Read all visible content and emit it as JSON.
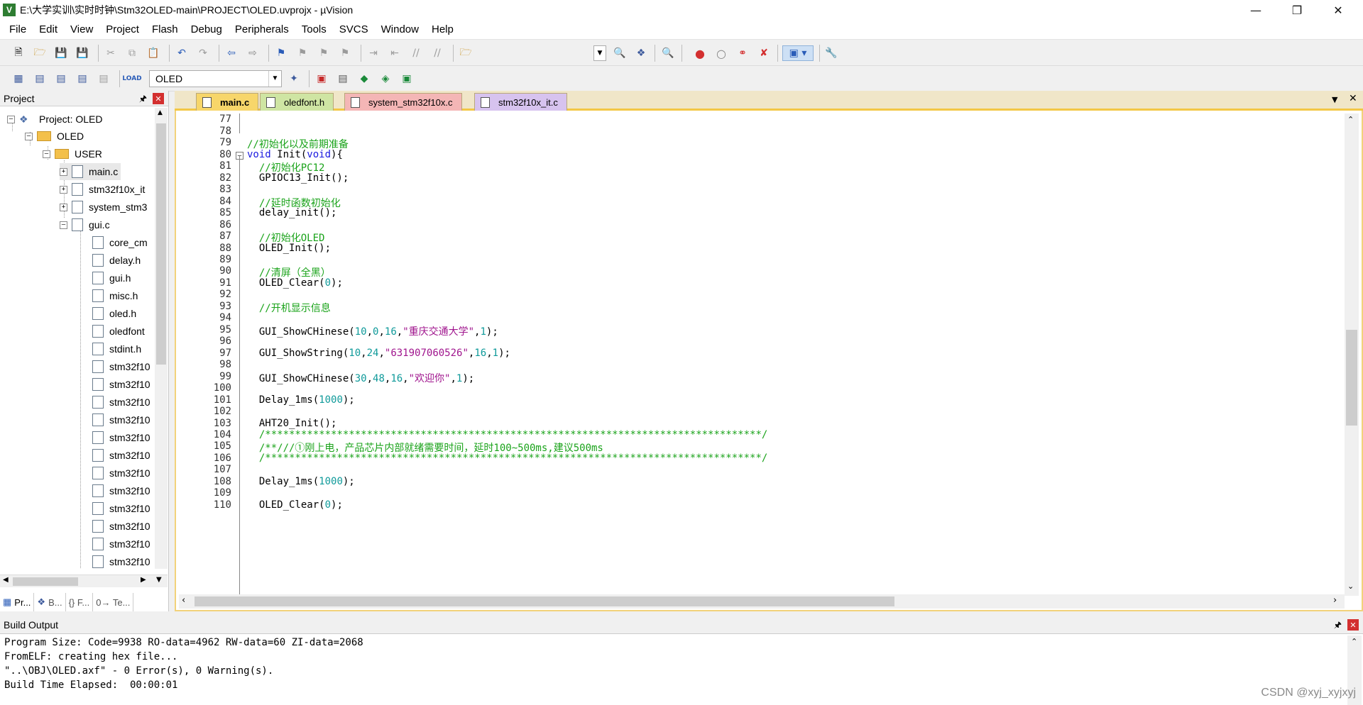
{
  "window": {
    "title": "E:\\大学实训\\实时时钟\\Stm32OLED-main\\PROJECT\\OLED.uvprojx - µVision",
    "app_icon": "V"
  },
  "menu": [
    "File",
    "Edit",
    "View",
    "Project",
    "Flash",
    "Debug",
    "Peripherals",
    "Tools",
    "SVCS",
    "Window",
    "Help"
  ],
  "toolbar": {
    "target_select": "OLED"
  },
  "project_panel": {
    "title": "Project",
    "tree": [
      {
        "label": "Project: OLED"
      },
      {
        "label": "OLED"
      },
      {
        "label": "USER"
      },
      {
        "label": "main.c"
      },
      {
        "label": "stm32f10x_it"
      },
      {
        "label": "system_stm3"
      },
      {
        "label": "gui.c"
      },
      {
        "label": "core_cm"
      },
      {
        "label": "delay.h"
      },
      {
        "label": "gui.h"
      },
      {
        "label": "misc.h"
      },
      {
        "label": "oled.h"
      },
      {
        "label": "oledfont"
      },
      {
        "label": "stdint.h"
      },
      {
        "label": "stm32f10"
      },
      {
        "label": "stm32f10"
      },
      {
        "label": "stm32f10"
      },
      {
        "label": "stm32f10"
      },
      {
        "label": "stm32f10"
      },
      {
        "label": "stm32f10"
      },
      {
        "label": "stm32f10"
      },
      {
        "label": "stm32f10"
      },
      {
        "label": "stm32f10"
      },
      {
        "label": "stm32f10"
      },
      {
        "label": "stm32f10"
      },
      {
        "label": "stm32f10"
      }
    ],
    "bottom_tabs": [
      "Pr...",
      "B...",
      "{} F...",
      "0→ Te..."
    ]
  },
  "editor": {
    "tabs": [
      {
        "label": "main.c",
        "active": true,
        "color": "#f7d66a"
      },
      {
        "label": "oledfont.h",
        "active": false,
        "color": "#cfe5a3"
      },
      {
        "label": "system_stm32f10x.c",
        "active": false,
        "color": "#f4b6b6"
      },
      {
        "label": "stm32f10x_it.c",
        "active": false,
        "color": "#d7c3ef"
      }
    ],
    "lines": [
      {
        "n": "77",
        "text": ""
      },
      {
        "n": "78",
        "text": ""
      },
      {
        "n": "79",
        "text": "//初始化以及前期准备"
      },
      {
        "n": "80",
        "text": "void Init(void){"
      },
      {
        "n": "81",
        "text": "  //初始化PC12"
      },
      {
        "n": "82",
        "text": "  GPIOC13_Init();"
      },
      {
        "n": "83",
        "text": ""
      },
      {
        "n": "84",
        "text": "  //延时函数初始化"
      },
      {
        "n": "85",
        "text": "  delay_init();"
      },
      {
        "n": "86",
        "text": ""
      },
      {
        "n": "87",
        "text": "  //初始化OLED"
      },
      {
        "n": "88",
        "text": "  OLED_Init();"
      },
      {
        "n": "89",
        "text": ""
      },
      {
        "n": "90",
        "text": "  //清屏（全黑）"
      },
      {
        "n": "91",
        "text": "  OLED_Clear(0);"
      },
      {
        "n": "92",
        "text": ""
      },
      {
        "n": "93",
        "text": "  //开机显示信息"
      },
      {
        "n": "94",
        "text": ""
      },
      {
        "n": "95",
        "text": "  GUI_ShowCHinese(10,0,16,\"重庆交通大学\",1);"
      },
      {
        "n": "96",
        "text": ""
      },
      {
        "n": "97",
        "text": "  GUI_ShowString(10,24,\"631907060526\",16,1);"
      },
      {
        "n": "98",
        "text": ""
      },
      {
        "n": "99",
        "text": "  GUI_ShowCHinese(30,48,16,\"欢迎你\",1);"
      },
      {
        "n": "100",
        "text": ""
      },
      {
        "n": "101",
        "text": "  Delay_1ms(1000);"
      },
      {
        "n": "102",
        "text": ""
      },
      {
        "n": "103",
        "text": "  AHT20_Init();"
      },
      {
        "n": "104",
        "text": "  /***********************************************************************************/"
      },
      {
        "n": "105",
        "text": "  /**///①刚上电，产品芯片内部就绪需要时间，延时100~500ms,建议500ms"
      },
      {
        "n": "106",
        "text": "  /***********************************************************************************/"
      },
      {
        "n": "107",
        "text": ""
      },
      {
        "n": "108",
        "text": "  Delay_1ms(1000);"
      },
      {
        "n": "109",
        "text": ""
      },
      {
        "n": "110",
        "text": "  OLED_Clear(0);"
      }
    ]
  },
  "build_output": {
    "title": "Build Output",
    "lines": [
      "Program Size: Code=9938 RO-data=4962 RW-data=60 ZI-data=2068",
      "FromELF: creating hex file...",
      "\"..\\OBJ\\OLED.axf\" - 0 Error(s), 0 Warning(s).",
      "Build Time Elapsed:  00:00:01"
    ]
  },
  "watermark": "CSDN @xyj_xyjxyj"
}
